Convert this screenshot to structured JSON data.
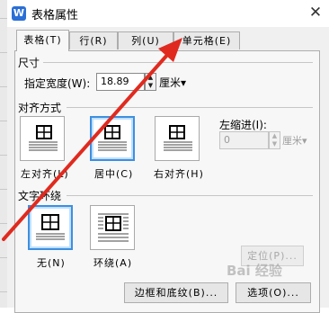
{
  "window": {
    "title": "表格属性",
    "app_icon": "W",
    "close_glyph": "✕"
  },
  "tabs": [
    {
      "label": "表格(T)",
      "active": true
    },
    {
      "label": "行(R)",
      "active": false
    },
    {
      "label": "列(U)",
      "active": false
    },
    {
      "label": "单元格(E)",
      "active": false
    }
  ],
  "size": {
    "group_label": "尺寸",
    "width_label": "指定宽度(W):",
    "width_value": "18.89",
    "width_checked": true,
    "width_unit": "厘米▾"
  },
  "alignment": {
    "group_label": "对齐方式",
    "options": [
      "左对齐(L)",
      "居中(C)",
      "右对齐(H)"
    ],
    "selected": "居中(C)",
    "indent_label": "左缩进(I):",
    "indent_value": "0",
    "indent_unit": "厘米▾"
  },
  "wrapping": {
    "group_label": "文字环绕",
    "options": [
      "无(N)",
      "环绕(A)"
    ],
    "selected": "无(N)"
  },
  "buttons": {
    "position": "定位(P)...",
    "borders": "边框和底纹(B)...",
    "options": "选项(O)..."
  },
  "annotation_color": "#e02a1f",
  "accent_color": "#3d8fe0",
  "watermark_text": "Bai 经验"
}
